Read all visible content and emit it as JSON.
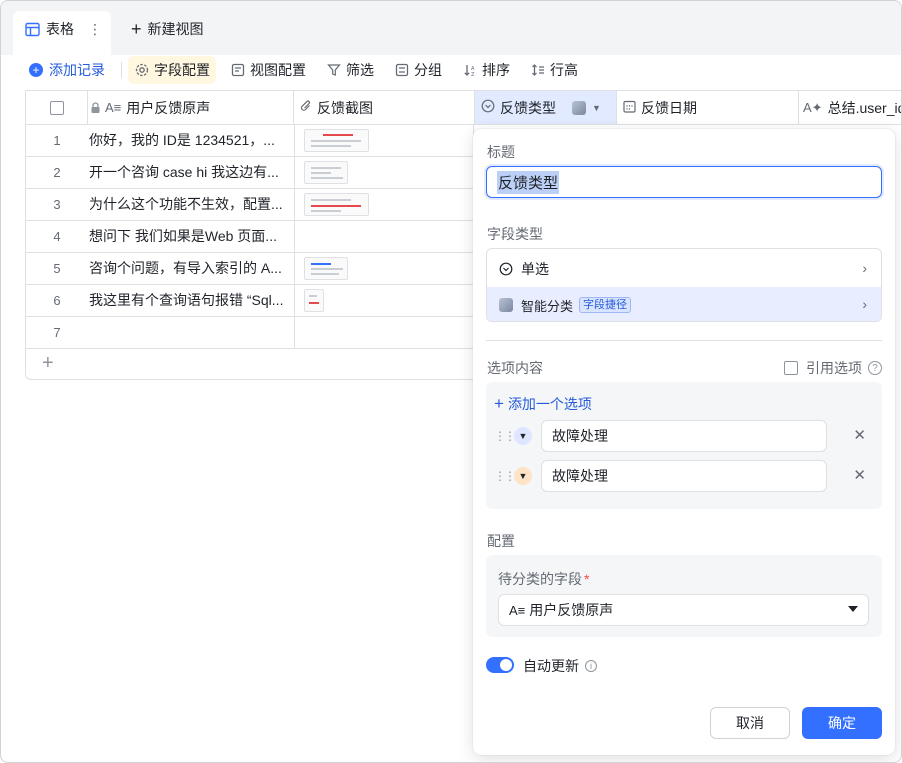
{
  "tabs": {
    "active_label": "表格",
    "more_icon": "⋮",
    "new_view_label": "新建视图"
  },
  "toolbar": {
    "add_record": "添加记录",
    "field_config": "字段配置",
    "view_config": "视图配置",
    "filter": "筛选",
    "group": "分组",
    "sort": "排序",
    "row_height": "行高"
  },
  "grid": {
    "columns": [
      {
        "label": "用户反馈原声",
        "icon": "text-icon"
      },
      {
        "label": "反馈截图",
        "icon": "attachment-icon"
      },
      {
        "label": "反馈类型",
        "icon": "single-select-icon"
      },
      {
        "label": "反馈日期",
        "icon": "date-icon"
      },
      {
        "label": "总结.user_id",
        "icon": "ai-text-icon"
      }
    ],
    "rows": [
      {
        "num": "1",
        "text": "你好，我的 ID是 1234521，..."
      },
      {
        "num": "2",
        "text": "开一个咨询 case hi 我这边有..."
      },
      {
        "num": "3",
        "text": "为什么这个功能不生效，配置..."
      },
      {
        "num": "4",
        "text": "想问下 我们如果是Web 页面..."
      },
      {
        "num": "5",
        "text": "咨询个问题，有导入索引的 A..."
      },
      {
        "num": "6",
        "text": "我这里有个查询语句报错 “Sql..."
      },
      {
        "num": "7",
        "text": ""
      }
    ]
  },
  "panel": {
    "title_label": "标题",
    "title_value": "反馈类型",
    "field_type_label": "字段类型",
    "type_single": "单选",
    "type_smart": "智能分类",
    "type_smart_badge": "字段捷径",
    "options_label": "选项内容",
    "ref_options_label": "引用选项",
    "add_option": "添加一个选项",
    "options": [
      {
        "value": "故障处理",
        "color": "#dfe6ff",
        "arrow_color": "#1f2329"
      },
      {
        "value": "故障处理",
        "color": "#ffe3c7",
        "arrow_color": "#1f2329"
      }
    ],
    "config_label": "配置",
    "source_field_label": "待分类的字段",
    "required_mark": "*",
    "source_field_value": "用户反馈原声",
    "auto_update_label": "自动更新",
    "cancel": "取消",
    "confirm": "确定"
  },
  "colors": {
    "accent": "#3370ff",
    "selected_header": "#e1eaff"
  }
}
